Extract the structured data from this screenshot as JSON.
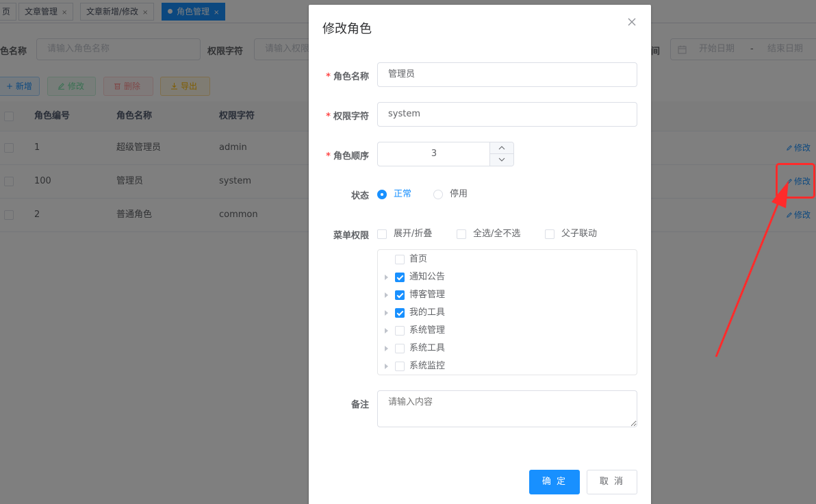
{
  "tabs": [
    {
      "label": "页",
      "closable": false
    },
    {
      "label": "文章管理",
      "closable": true
    },
    {
      "label": "文章新增/修改",
      "closable": true
    },
    {
      "label": "角色管理",
      "closable": true,
      "active": true
    }
  ],
  "tab_close_glyph": "×",
  "search": {
    "role_name_label": "色名称",
    "role_name_placeholder": "请输入角色名称",
    "perm_label": "权限字符",
    "perm_placeholder": "请输入权限",
    "time_label": "间",
    "start_placeholder": "开始日期",
    "range_sep": "-",
    "end_placeholder": "结束日期"
  },
  "toolbar": {
    "add_label": "+ 新增",
    "edit_label": "修改",
    "delete_label": "删除",
    "export_label": "导出"
  },
  "table": {
    "columns": [
      "角色编号",
      "角色名称",
      "权限字符"
    ],
    "rows": [
      {
        "id": "1",
        "name": "超级管理员",
        "key": "admin"
      },
      {
        "id": "100",
        "name": "管理员",
        "key": "system"
      },
      {
        "id": "2",
        "name": "普通角色",
        "key": "common"
      }
    ],
    "row_action": "修改"
  },
  "dialog": {
    "title": "修改角色",
    "close_glyph": "×",
    "required_mark": "*",
    "fields": {
      "name_label": "角色名称",
      "name_value": "管理员",
      "key_label": "权限字符",
      "key_value": "system",
      "sort_label": "角色顺序",
      "sort_value": "3",
      "status_label": "状态",
      "status_options": [
        "正常",
        "停用"
      ],
      "status_selected": "正常",
      "menu_label": "菜单权限",
      "menu_options": [
        "展开/折叠",
        "全选/全不选",
        "父子联动"
      ],
      "remark_label": "备注",
      "remark_placeholder": "请输入内容"
    },
    "tree": [
      {
        "label": "首页",
        "checked": false,
        "has_children": false
      },
      {
        "label": "通知公告",
        "checked": true,
        "has_children": true
      },
      {
        "label": "博客管理",
        "checked": true,
        "has_children": true
      },
      {
        "label": "我的工具",
        "checked": true,
        "has_children": true
      },
      {
        "label": "系统管理",
        "checked": false,
        "has_children": true
      },
      {
        "label": "系统工具",
        "checked": false,
        "has_children": true
      },
      {
        "label": "系统监控",
        "checked": false,
        "has_children": true
      }
    ],
    "confirm_label": "确 定",
    "cancel_label": "取 消"
  },
  "colors": {
    "primary": "#1890ff",
    "success": "#13ce66",
    "danger": "#ff4949",
    "warning": "#ffba00",
    "annotation": "#ff2b2b"
  }
}
